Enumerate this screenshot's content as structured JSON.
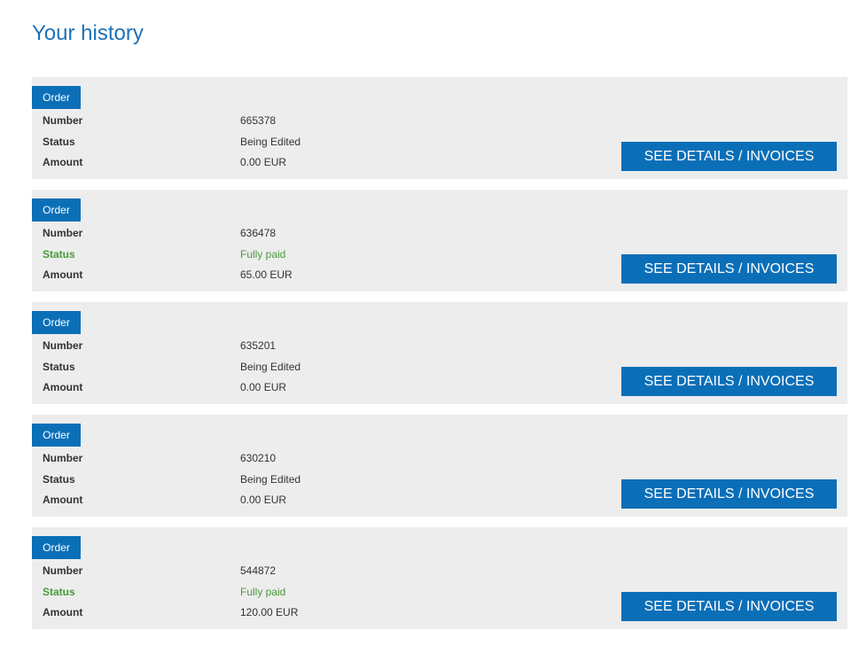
{
  "page": {
    "title": "Your history"
  },
  "labels": {
    "badge": "Order",
    "number": "Number",
    "status": "Status",
    "amount": "Amount",
    "button": "SEE DETAILS / INVOICES"
  },
  "colors": {
    "accent": "#0b6fb8",
    "title": "#1d72b8",
    "paid_status": "#4a9a3b",
    "card_background": "#ededed"
  },
  "orders": [
    {
      "number": "665378",
      "status": "Being Edited",
      "amount": "0.00 EUR",
      "status_type": "editing"
    },
    {
      "number": "636478",
      "status": "Fully paid",
      "amount": "65.00 EUR",
      "status_type": "paid"
    },
    {
      "number": "635201",
      "status": "Being Edited",
      "amount": "0.00 EUR",
      "status_type": "editing"
    },
    {
      "number": "630210",
      "status": "Being Edited",
      "amount": "0.00 EUR",
      "status_type": "editing"
    },
    {
      "number": "544872",
      "status": "Fully paid",
      "amount": "120.00 EUR",
      "status_type": "paid"
    }
  ]
}
